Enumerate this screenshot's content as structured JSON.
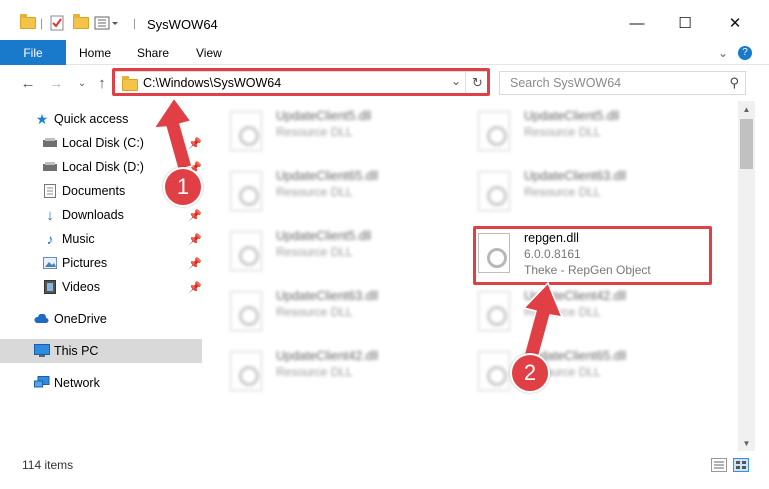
{
  "window": {
    "title": "SysWOW64",
    "minimize_icon": "minimize-icon",
    "maximize_icon": "maximize-icon",
    "close_icon": "close-icon"
  },
  "ribbon": {
    "tabs": [
      {
        "label": "File"
      },
      {
        "label": "Home"
      },
      {
        "label": "Share"
      },
      {
        "label": "View"
      }
    ]
  },
  "address": {
    "path": "C:\\Windows\\SysWOW64"
  },
  "search": {
    "placeholder": "Search SysWOW64"
  },
  "sidebar": {
    "items": [
      {
        "label": "Quick access",
        "icon": "star-icon"
      },
      {
        "label": "Local Disk (C:)",
        "icon": "drive-icon"
      },
      {
        "label": "Local Disk (D:)",
        "icon": "drive-icon"
      },
      {
        "label": "Documents",
        "icon": "documents-icon"
      },
      {
        "label": "Downloads",
        "icon": "download-icon"
      },
      {
        "label": "Music",
        "icon": "music-icon"
      },
      {
        "label": "Pictures",
        "icon": "pictures-icon"
      },
      {
        "label": "Videos",
        "icon": "videos-icon"
      },
      {
        "label": "OneDrive",
        "icon": "cloud-icon"
      },
      {
        "label": "This PC",
        "icon": "computer-icon"
      },
      {
        "label": "Network",
        "icon": "network-icon"
      }
    ]
  },
  "files": {
    "left": [
      {
        "name": "UpdateClient5.dll",
        "type": "Resource DLL"
      },
      {
        "name": "UpdateClient65.dll",
        "type": "Resource DLL"
      },
      {
        "name": "UpdateClient5.dll",
        "type": "Resource DLL"
      },
      {
        "name": "UpdateClient63.dll",
        "type": "Resource DLL"
      },
      {
        "name": "UpdateClient42.dll",
        "type": "Resource DLL"
      }
    ],
    "right": [
      {
        "name": "UpdateClient5.dll",
        "type": "Resource DLL"
      },
      {
        "name": "UpdateClient63.dll",
        "type": "Resource DLL"
      },
      {
        "name": "repgen.dll",
        "version": "6.0.0.8161",
        "description": "Theke - RepGen Object"
      },
      {
        "name": "UpdateClient42.dll",
        "type": "Resource DLL"
      },
      {
        "name": "UpdateClient65.dll",
        "type": "Resource DLL"
      }
    ]
  },
  "callouts": [
    "1",
    "2"
  ],
  "status": {
    "item_count": "114 items"
  },
  "colors": {
    "accent": "#1979ca",
    "highlight": "#e04045",
    "selected": "#d9d9d9"
  }
}
